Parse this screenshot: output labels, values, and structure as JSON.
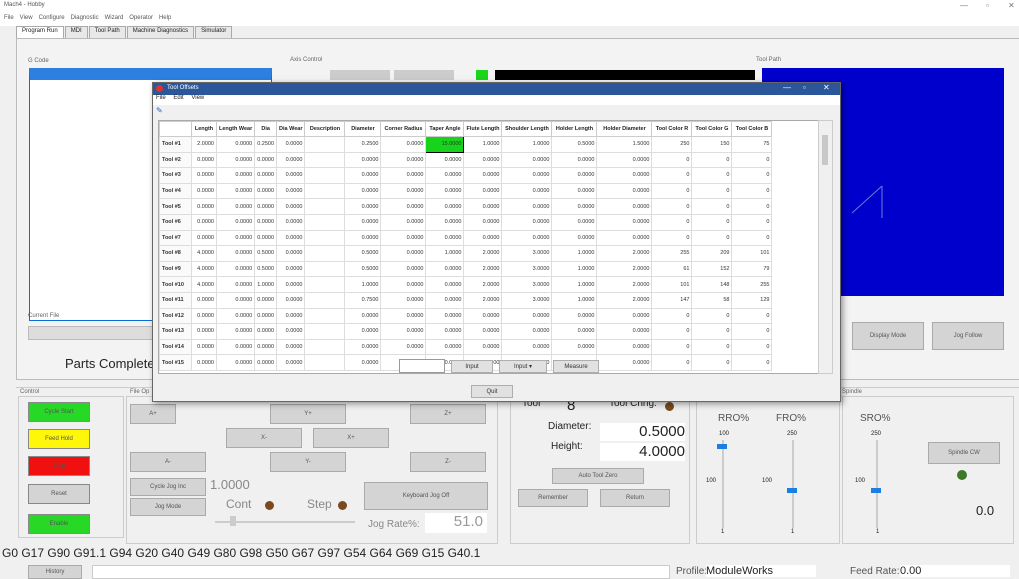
{
  "app": {
    "title": "Mach4 - Hobby",
    "menu": [
      "File",
      "View",
      "Configure",
      "Diagnostic",
      "Wizard",
      "Operator",
      "Help"
    ]
  },
  "tabs": [
    "Program Run",
    "MDI",
    "Tool Path",
    "Machine Diagnostics",
    "Simulator"
  ],
  "panels": {
    "gcode_label": "G Code",
    "axis_label": "Axis Control",
    "toolpath_label": "Tool Path",
    "current_file_label": "Current File",
    "parts_complete": "Parts Complete",
    "control_label": "Control",
    "file_ops_label": "File Op",
    "spindle_label": "Spindle",
    "display_mode": "Display Mode",
    "jog_follow": "Jog Follow"
  },
  "control_buttons": [
    "Cycle Start",
    "Feed Hold",
    "Stop",
    "Reset",
    "Enable"
  ],
  "jog": {
    "buttons": [
      "A+",
      "Y+",
      "Z+",
      "X-",
      "X+",
      "A-",
      "Y-",
      "Z-"
    ],
    "cycle_jog": "Cycle Jog Inc",
    "jog_mode": "Jog Mode",
    "increment": "1.0000",
    "cont": "Cont",
    "step": "Step",
    "keyboard_jog": "Keyboard Jog Off",
    "jog_rate_label": "Jog Rate%:",
    "jog_rate": "51.0"
  },
  "tool": {
    "tool_label": "Tool",
    "tool_value": "8",
    "tool_change": "Tool Chng.",
    "diameter_label": "Diameter:",
    "diameter": "0.5000",
    "height_label": "Height:",
    "height": "4.0000",
    "auto_tool_zero": "Auto Tool Zero",
    "remember": "Remember",
    "return": "Return"
  },
  "overrides": {
    "rro": "RRO%",
    "fro": "FRO%",
    "sro": "SRO%",
    "rro_max": "100",
    "fro_max": "250",
    "sro_max": "250",
    "rro_mid": "100",
    "fro_mid": "100",
    "sro_mid": "100",
    "rro_min": "1",
    "fro_min": "1",
    "sro_min": "1",
    "spindle_cw": "Spindle CW",
    "spindle_value": "0.0"
  },
  "gcode_modal": "G0 G17 G90 G91.1 G94 G20 G40 G49 G80 G98 G50 G67 G97 G54 G64 G69 G15 G40.1",
  "status": {
    "history": "History",
    "profile_label": "Profile:",
    "profile": "ModuleWorks",
    "feed_label": "Feed Rate:",
    "feed": "0.00"
  },
  "dialog": {
    "title": "Tool Offsets",
    "menu": [
      "File",
      "Edit",
      "View"
    ],
    "buttons": {
      "input": "Input",
      "input_menu": "Input ▾",
      "measure": "Measure",
      "quit": "Quit"
    },
    "columns": [
      "",
      "Length",
      "Length Wear",
      "Dia",
      "Dia Wear",
      "Description",
      "Diameter",
      "Corner Radius",
      "Taper Angle",
      "Flute Length",
      "Shoulder Length",
      "Holder Length",
      "Holder Diameter",
      "Tool Color R",
      "Tool Color G",
      "Tool Color B"
    ],
    "rows": [
      [
        "Tool #1",
        "2.0000",
        "0.0000",
        "0.2500",
        "0.0000",
        "",
        "0.2500",
        "0.0000",
        "15.0000",
        "1.0000",
        "1.0000",
        "0.5000",
        "1.5000",
        "250",
        "150",
        "75"
      ],
      [
        "Tool #2",
        "0.0000",
        "0.0000",
        "0.0000",
        "0.0000",
        "",
        "0.0000",
        "0.0000",
        "0.0000",
        "0.0000",
        "0.0000",
        "0.0000",
        "0.0000",
        "0",
        "0",
        "0"
      ],
      [
        "Tool #3",
        "0.0000",
        "0.0000",
        "0.0000",
        "0.0000",
        "",
        "0.0000",
        "0.0000",
        "0.0000",
        "0.0000",
        "0.0000",
        "0.0000",
        "0.0000",
        "0",
        "0",
        "0"
      ],
      [
        "Tool #4",
        "0.0000",
        "0.0000",
        "0.0000",
        "0.0000",
        "",
        "0.0000",
        "0.0000",
        "0.0000",
        "0.0000",
        "0.0000",
        "0.0000",
        "0.0000",
        "0",
        "0",
        "0"
      ],
      [
        "Tool #5",
        "0.0000",
        "0.0000",
        "0.0000",
        "0.0000",
        "",
        "0.0000",
        "0.0000",
        "0.0000",
        "0.0000",
        "0.0000",
        "0.0000",
        "0.0000",
        "0",
        "0",
        "0"
      ],
      [
        "Tool #6",
        "0.0000",
        "0.0000",
        "0.0000",
        "0.0000",
        "",
        "0.0000",
        "0.0000",
        "0.0000",
        "0.0000",
        "0.0000",
        "0.0000",
        "0.0000",
        "0",
        "0",
        "0"
      ],
      [
        "Tool #7",
        "0.0000",
        "0.0000",
        "0.0000",
        "0.0000",
        "",
        "0.0000",
        "0.0000",
        "0.0000",
        "0.0000",
        "0.0000",
        "0.0000",
        "0.0000",
        "0",
        "0",
        "0"
      ],
      [
        "Tool #8",
        "4.0000",
        "0.0000",
        "0.5000",
        "0.0000",
        "",
        "0.5000",
        "0.0000",
        "1.0000",
        "2.0000",
        "3.0000",
        "1.0000",
        "2.0000",
        "255",
        "209",
        "101"
      ],
      [
        "Tool #9",
        "4.0000",
        "0.0000",
        "0.5000",
        "0.0000",
        "",
        "0.5000",
        "0.0000",
        "0.0000",
        "2.0000",
        "3.0000",
        "1.0000",
        "2.0000",
        "61",
        "152",
        "79"
      ],
      [
        "Tool #10",
        "4.0000",
        "0.0000",
        "1.0000",
        "0.0000",
        "",
        "1.0000",
        "0.0000",
        "0.0000",
        "2.0000",
        "3.0000",
        "1.0000",
        "2.0000",
        "101",
        "148",
        "255"
      ],
      [
        "Tool #11",
        "0.0000",
        "0.0000",
        "0.0000",
        "0.0000",
        "",
        "0.7500",
        "0.0000",
        "0.0000",
        "2.0000",
        "3.0000",
        "1.0000",
        "2.0000",
        "147",
        "58",
        "129"
      ],
      [
        "Tool #12",
        "0.0000",
        "0.0000",
        "0.0000",
        "0.0000",
        "",
        "0.0000",
        "0.0000",
        "0.0000",
        "0.0000",
        "0.0000",
        "0.0000",
        "0.0000",
        "0",
        "0",
        "0"
      ],
      [
        "Tool #13",
        "0.0000",
        "0.0000",
        "0.0000",
        "0.0000",
        "",
        "0.0000",
        "0.0000",
        "0.0000",
        "0.0000",
        "0.0000",
        "0.0000",
        "0.0000",
        "0",
        "0",
        "0"
      ],
      [
        "Tool #14",
        "0.0000",
        "0.0000",
        "0.0000",
        "0.0000",
        "",
        "0.0000",
        "0.0000",
        "0.0000",
        "0.0000",
        "0.0000",
        "0.0000",
        "0.0000",
        "0",
        "0",
        "0"
      ],
      [
        "Tool #15",
        "0.0000",
        "0.0000",
        "0.0000",
        "0.0000",
        "",
        "0.0000",
        "0.0000",
        "0.0000",
        "0.0000",
        "0.0000",
        "0.0000",
        "0.0000",
        "0",
        "0",
        "0"
      ]
    ]
  }
}
